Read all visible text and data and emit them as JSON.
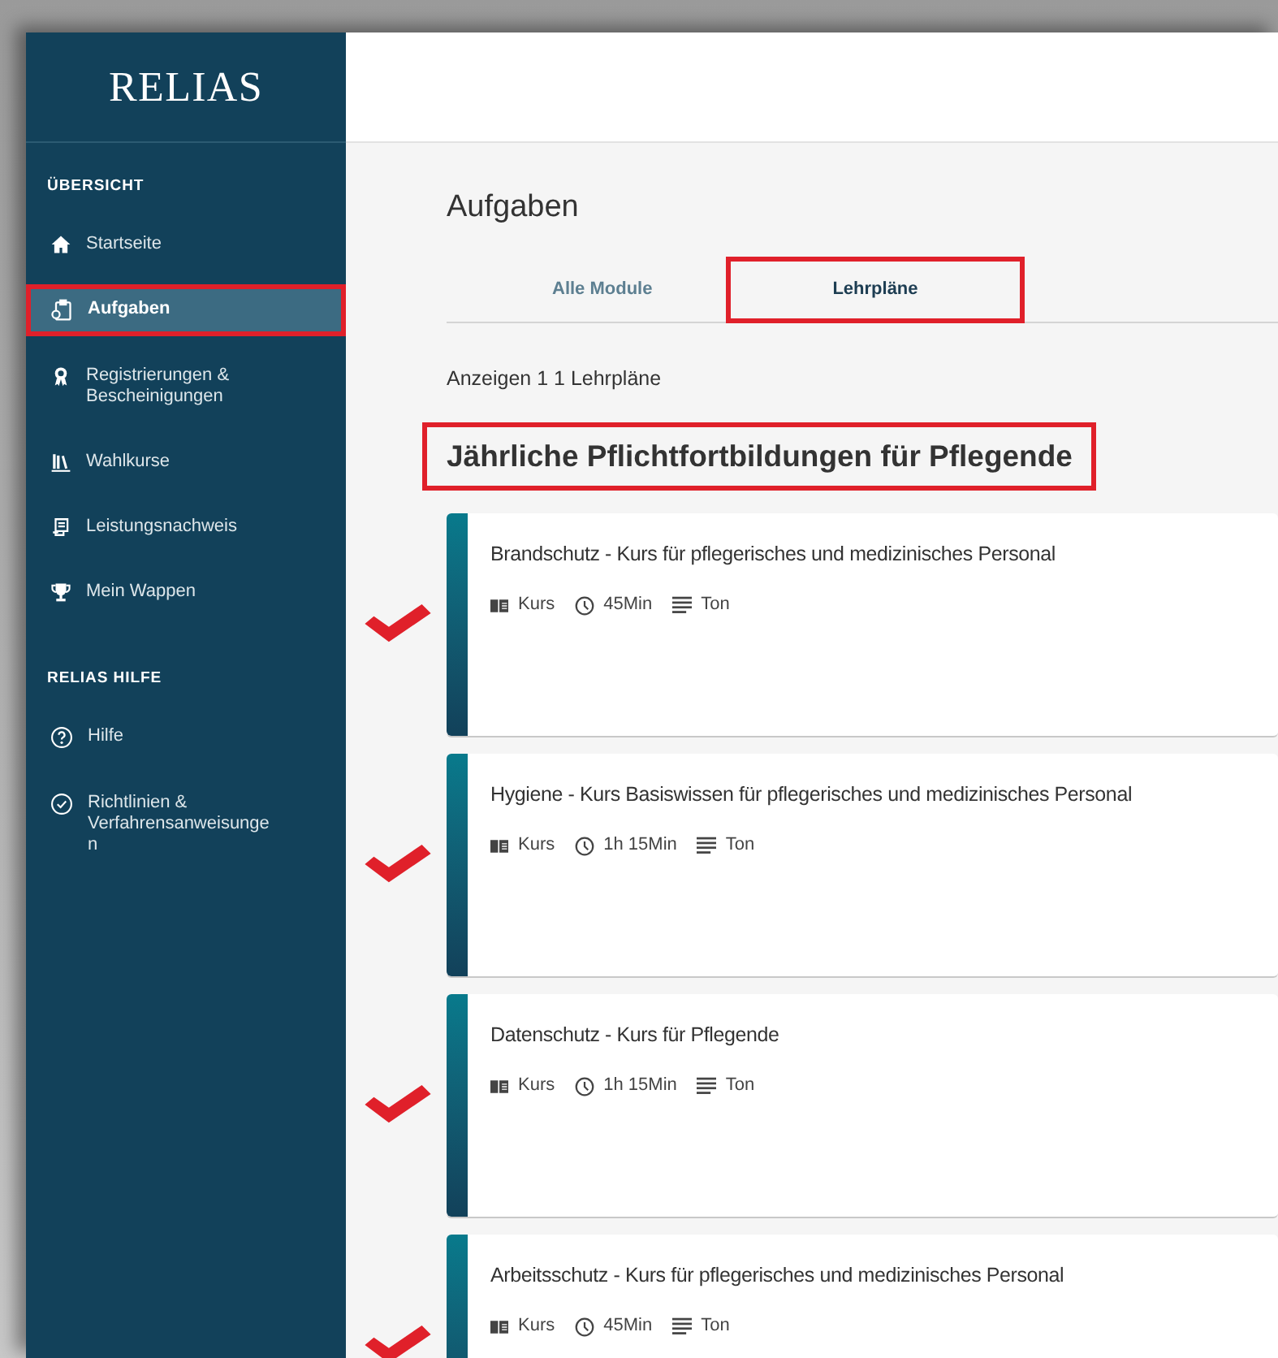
{
  "logo": "RELIAS",
  "sidebar": {
    "sections": [
      {
        "heading": "ÜBERSICHT",
        "items": [
          {
            "label": "Startseite",
            "kind": "home",
            "selected": false,
            "highlighted": false
          },
          {
            "label": "Aufgaben",
            "kind": "clipboard",
            "selected": true,
            "highlighted": true
          },
          {
            "label": "Registrierungen & Bescheinigungen",
            "kind": "award",
            "selected": false,
            "highlighted": false
          },
          {
            "label": "Wahlkurse",
            "kind": "books",
            "selected": false,
            "highlighted": false
          },
          {
            "label": "Leistungsnachweis",
            "kind": "scroll",
            "selected": false,
            "highlighted": false
          },
          {
            "label": "Mein Wappen",
            "kind": "trophy",
            "selected": false,
            "highlighted": false
          }
        ]
      },
      {
        "heading": "RELIAS HILFE",
        "items": [
          {
            "label": "Hilfe",
            "kind": "question",
            "selected": false,
            "highlighted": false
          },
          {
            "label": "Richtlinien & Verfahrensanweisungen",
            "kind": "checkcircle",
            "selected": false,
            "highlighted": false
          }
        ]
      }
    ]
  },
  "page": {
    "title": "Aufgaben",
    "tabs": [
      {
        "label": "Alle Module",
        "selected": false,
        "highlighted": false
      },
      {
        "label": "Lehrpläne",
        "selected": true,
        "highlighted": true
      }
    ],
    "count": "Anzeigen 1 1 Lehrpläne",
    "curriculum": {
      "title": "Jährliche Pflichtfortbildungen für Pflegende",
      "highlighted": true
    },
    "courses": [
      {
        "title": "Brandschutz - Kurs für pflegerisches und medizinisches Personal",
        "checked": true,
        "type": "Kurs",
        "duration": "45Min",
        "media": "Ton"
      },
      {
        "title": "Hygiene - Kurs Basiswissen für pflegerisches und medizinisches Personal",
        "checked": true,
        "type": "Kurs",
        "duration": "1h 15Min",
        "media": "Ton"
      },
      {
        "title": "Datenschutz - Kurs für Pflegende",
        "checked": true,
        "type": "Kurs",
        "duration": "1h 15Min",
        "media": "Ton"
      },
      {
        "title": "Arbeitsschutz - Kurs für pflegerisches und medizinisches Personal",
        "checked": true,
        "type": "Kurs",
        "duration": "45Min",
        "media": "Ton"
      }
    ]
  }
}
